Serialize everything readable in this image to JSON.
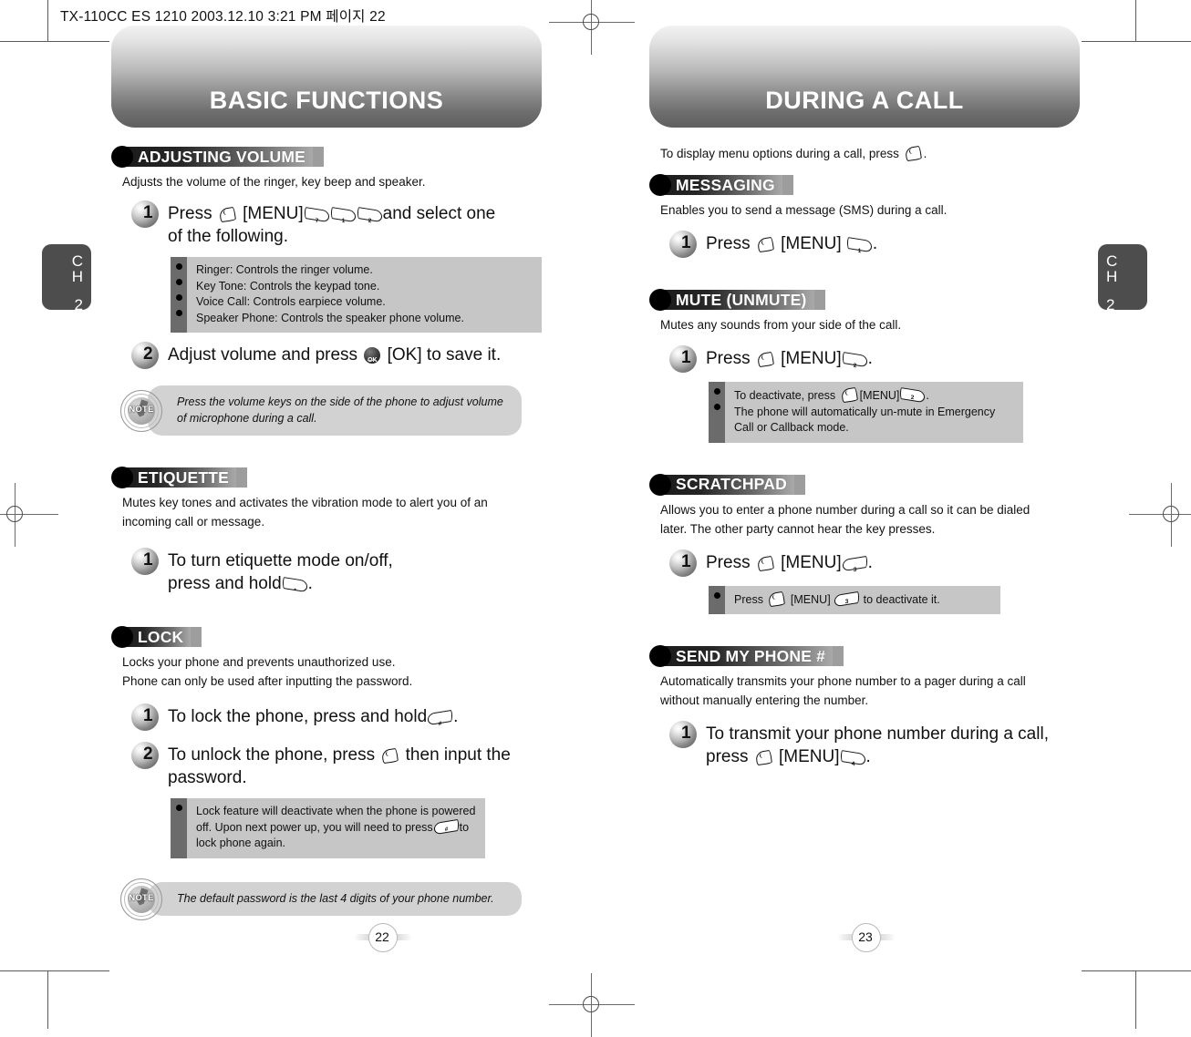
{
  "print_marks": {
    "slug_line": "TX-110CC ES 1210  2003.12.10 3:21 PM  페이지 22"
  },
  "left_page": {
    "banner_title": "BASIC FUNCTIONS",
    "chapter_tab": {
      "line1": "C",
      "line2": "H",
      "line3": "2"
    },
    "page_number": "22",
    "sections": [
      {
        "badge": "ADJUSTING VOLUME",
        "lead": "Adjusts the volume of the ringer, key beep and speaker.",
        "step1_num": "1",
        "step1_a": "Press",
        "step1_b": "[MENU]",
        "step1_c": "and select one",
        "step1_d": "of the following.",
        "keys": [
          "7",
          "1",
          "2"
        ],
        "bullets": [
          "Ringer: Controls the ringer volume.",
          "Key Tone: Controls the keypad tone.",
          "Voice Call: Controls earpiece volume.",
          "Speaker Phone: Controls the speaker phone volume."
        ],
        "step2_num": "2",
        "step2_a": "Adjust volume and press",
        "step2_b": "[OK] to save it.",
        "note": "Press the volume keys on the side of the phone to adjust volume of microphone during a call."
      },
      {
        "badge": "ETIQUETTE",
        "lead1": "Mutes key tones and activates the vibration mode to alert you of an",
        "lead2": "incoming call or message.",
        "step1_num": "1",
        "step1_a": "To turn etiquette mode on/off,",
        "step1_b": "press and hold",
        "step1_c": ".",
        "key": "*"
      },
      {
        "badge": "LOCK",
        "lead1": "Locks your phone and prevents unauthorized use.",
        "lead2": "Phone can only be used after inputting the password.",
        "step1_num": "1",
        "step1_a": "To lock the phone, press and hold",
        "step1_b": ".",
        "step1_key": "#",
        "step2_num": "2",
        "step2_a": "To unlock the phone, press",
        "step2_b": "then input the",
        "step2_c": "password.",
        "bullet_a": "Lock feature will deactivate when the phone is powered",
        "bullet_b": "off. Upon next power up, you will need to press",
        "bullet_c": "to",
        "bullet_d": "lock phone again.",
        "bullet_key": "#",
        "note": "The default password is the last 4 digits of your phone number."
      }
    ]
  },
  "right_page": {
    "banner_title": "DURING A CALL",
    "chapter_tab": {
      "line1": "C",
      "line2": "H",
      "line3": "2"
    },
    "page_number": "23",
    "intro_a": "To display menu options during a call, press",
    "intro_b": ".",
    "sections": [
      {
        "badge": "MESSAGING",
        "lead": "Enables you to send a message (SMS) during a call.",
        "step1_num": "1",
        "step1_a": "Press",
        "step1_b": "[MENU]",
        "step1_c": ".",
        "key": "1"
      },
      {
        "badge": "MUTE (UNMUTE)",
        "lead": "Mutes any sounds from your side of the call.",
        "step1_num": "1",
        "step1_a": "Press",
        "step1_b": "[MENU]",
        "step1_c": ".",
        "key": "2",
        "bullet1_a": "To deactivate, press",
        "bullet1_b": "[MENU]",
        "bullet1_c": ".",
        "bullet1_key": "2",
        "bullet2_a": "The phone will automatically un-mute in Emergency",
        "bullet2_b": "Call or Callback mode."
      },
      {
        "badge": "SCRATCHPAD",
        "lead1": "Allows you to enter a phone number during a call so it can be dialed",
        "lead2": "later. The other party cannot hear the key presses.",
        "step1_num": "1",
        "step1_a": "Press",
        "step1_b": "[MENU]",
        "step1_c": ".",
        "key": "3",
        "bullet_a": "Press",
        "bullet_b": "[MENU]",
        "bullet_c": "to deactivate it.",
        "bullet_key": "3"
      },
      {
        "badge": "SEND MY PHONE #",
        "lead1": "Automatically transmits your phone number to a pager during a call",
        "lead2": "without manually entering the number.",
        "step1_num": "1",
        "step1_a": "To transmit your phone number during a call,",
        "step1_b": "press",
        "step1_c": "[MENU]",
        "step1_d": ".",
        "key": "4"
      }
    ]
  },
  "icons": {
    "menu_softkey": "menu-softkey-icon",
    "ok_key": "ok-key-icon",
    "note": "note-icon"
  },
  "colors": {
    "badge_dark": "#1b1b1b",
    "badge_light": "#a9a9a9",
    "gray_box": "#c6c6c6",
    "gray_strip": "#6b6b6b",
    "note_box": "#d2d2d2",
    "tab": "#4d4d4d"
  }
}
